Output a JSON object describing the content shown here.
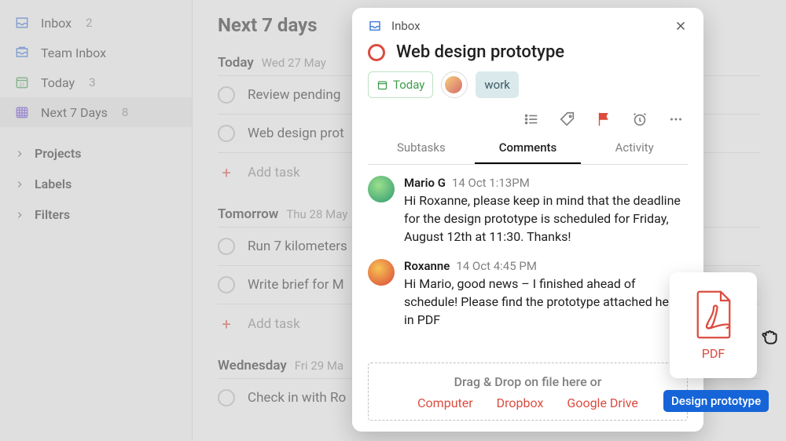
{
  "sidebar": {
    "items": [
      {
        "label": "Inbox",
        "count": "2"
      },
      {
        "label": "Team Inbox",
        "count": ""
      },
      {
        "label": "Today",
        "count": "3"
      },
      {
        "label": "Next 7 Days",
        "count": "8"
      }
    ],
    "sections": [
      "Projects",
      "Labels",
      "Filters"
    ]
  },
  "main": {
    "title": "Next 7 days",
    "groups": [
      {
        "name": "Today",
        "date": "Wed 27 May",
        "tasks": [
          "Review pending",
          "Web design prot"
        ],
        "add": "Add task"
      },
      {
        "name": "Tomorrow",
        "date": "Thu 28 May",
        "tasks": [
          "Run 7 kilometers",
          "Write brief for M"
        ],
        "add": "Add task"
      },
      {
        "name": "Wednesday",
        "date": "Fri 29 Ma",
        "tasks": [
          "Check in with Ro"
        ],
        "add": ""
      }
    ]
  },
  "modal": {
    "crumb": "Inbox",
    "title": "Web design prototype",
    "chips": {
      "today": "Today",
      "work": "work"
    },
    "tabs": [
      "Subtasks",
      "Comments",
      "Activity"
    ],
    "active_tab": 1,
    "comments": [
      {
        "author": "Mario G",
        "ts": "14 Oct 1:13PM",
        "body": "Hi Roxanne, please keep in mind that the deadline for the design prototype is scheduled for Friday, August 12th at 11:30. Thanks!"
      },
      {
        "author": "Roxanne",
        "ts": "14 Oct 4:45 PM",
        "body": "Hi Mario, good news – I finished ahead of schedule! Please find the prototype attached here, in PDF"
      }
    ],
    "dropzone": {
      "title": "Drag & Drop on file here or",
      "links": [
        "Computer",
        "Dropbox",
        "Google Drive"
      ]
    }
  },
  "floating": {
    "pdf_label": "PDF",
    "file_name": "Design prototype"
  }
}
